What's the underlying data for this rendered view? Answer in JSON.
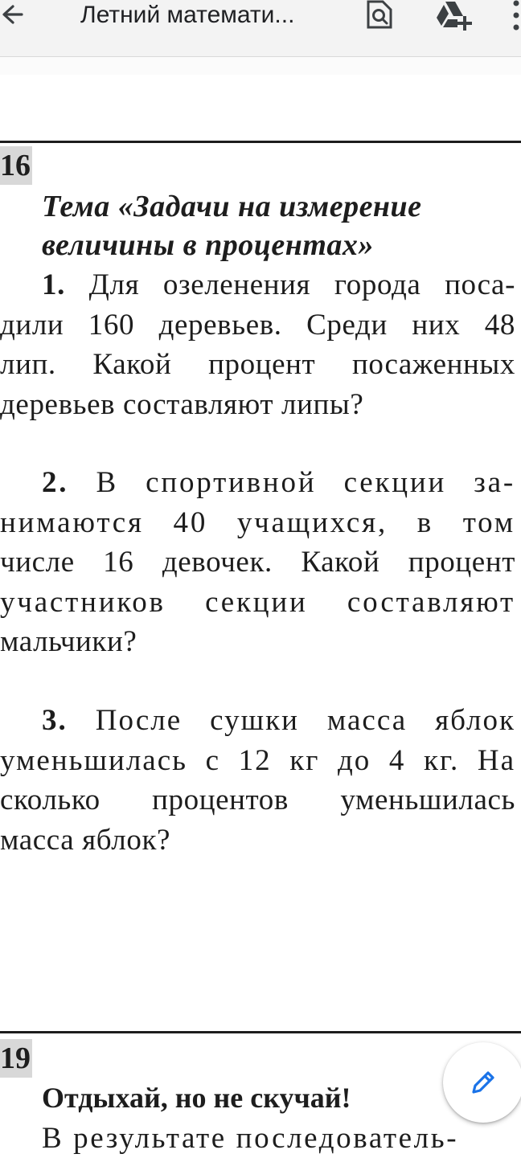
{
  "app_bar": {
    "title": "Летний математи...",
    "icons": [
      "back-arrow-icon",
      "search-in-document-icon",
      "add-to-drive-icon",
      "more-vert-icon"
    ]
  },
  "document": {
    "section_16": {
      "number": "16",
      "topic_line1": "Тема «Задачи на измерение",
      "topic_line2": "величины в процентах»",
      "problems": [
        {
          "num": "1.",
          "line1": " Для озеленения города поса-",
          "line2": "дили 160 деревьев. Среди них 48",
          "line3": "лип. Какой процент посаженных",
          "line4": "деревьев составляют липы?"
        },
        {
          "num": "2.",
          "line1": " В спортивной секции за-",
          "line2": "нимаются 40 учащихся, в том",
          "line3": "числе 16 девочек. Какой процент",
          "line4": "участников секции составляют",
          "line5": "мальчики?"
        },
        {
          "num": "3.",
          "line1": " После сушки масса яблок",
          "line2": "уменьшилась с 12 кг до 4 кг. На",
          "line3": "сколько процентов уменьшилась",
          "line4": "масса яблок?"
        }
      ]
    },
    "section_19": {
      "number": "19",
      "title": "Отдыхай, но не скучай!",
      "first_line": "В результате последователь-"
    }
  },
  "fab": {
    "icon": "edit-pencil-icon",
    "color": "#1a73e8"
  },
  "colors": {
    "app_bar_bg": "#f3f3f3",
    "page_number_bg": "#d8d8d8",
    "text": "#1d1d1d"
  }
}
